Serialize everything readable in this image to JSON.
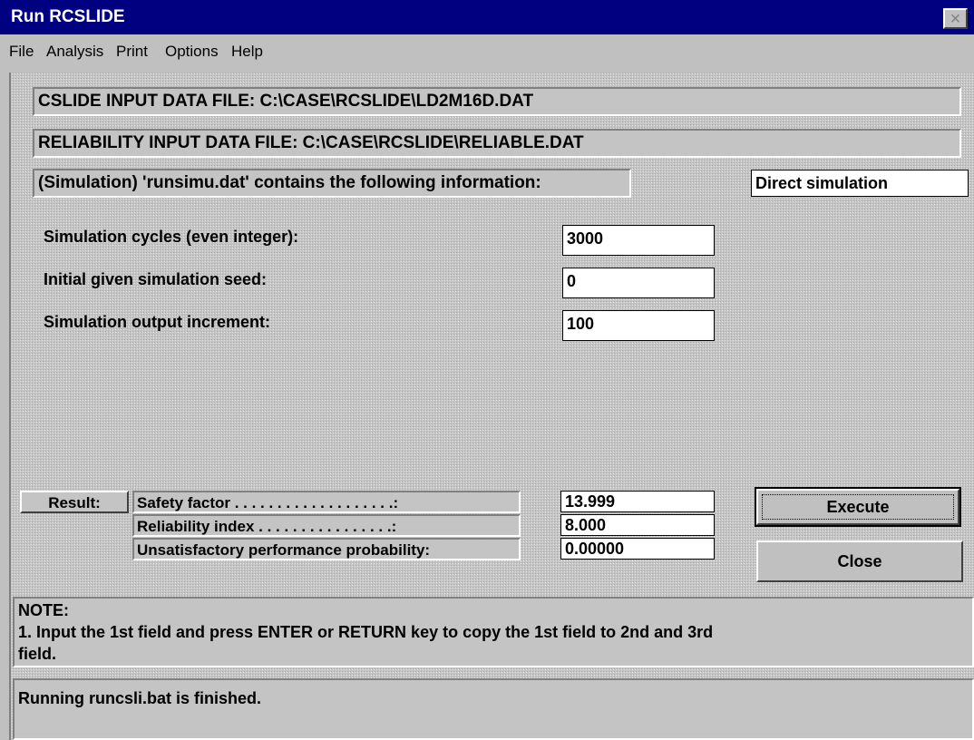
{
  "window": {
    "title": "Run RCSLIDE",
    "close_glyph": "×"
  },
  "menu": {
    "items": [
      "File",
      "Analysis",
      "Print",
      "Options",
      "Help"
    ]
  },
  "files": {
    "cslide": "CSLIDE INPUT DATA FILE: C:\\CASE\\RCSLIDE\\LD2M16D.DAT",
    "reliability": "RELIABILITY INPUT DATA FILE: C:\\CASE\\RCSLIDE\\RELIABLE.DAT"
  },
  "simulation": {
    "info_label": "(Simulation) 'runsimu.dat' contains the following information:",
    "mode": "Direct simulation",
    "fields": [
      {
        "label": "Simulation cycles (even integer):",
        "value": "3000"
      },
      {
        "label": "Initial given simulation seed:",
        "value": "0"
      },
      {
        "label": "Simulation output increment:",
        "value": "100"
      }
    ]
  },
  "result": {
    "label": "Result:",
    "rows": [
      {
        "label": "Safety factor . . . . . . . . . . . . . . . . . . .:",
        "value": "13.999"
      },
      {
        "label": "Reliability index . . . . . . . . . . . . . . . .:",
        "value": "8.000"
      },
      {
        "label": "Unsatisfactory performance probability:",
        "value": "0.00000"
      }
    ]
  },
  "buttons": {
    "execute": "Execute",
    "close": "Close"
  },
  "note": {
    "title": "NOTE:",
    "line1": "1. Input the 1st field and press ENTER or RETURN key to copy the 1st field to 2nd and 3rd",
    "line2": "field."
  },
  "status": {
    "text": "Running runcsli.bat is finished."
  }
}
